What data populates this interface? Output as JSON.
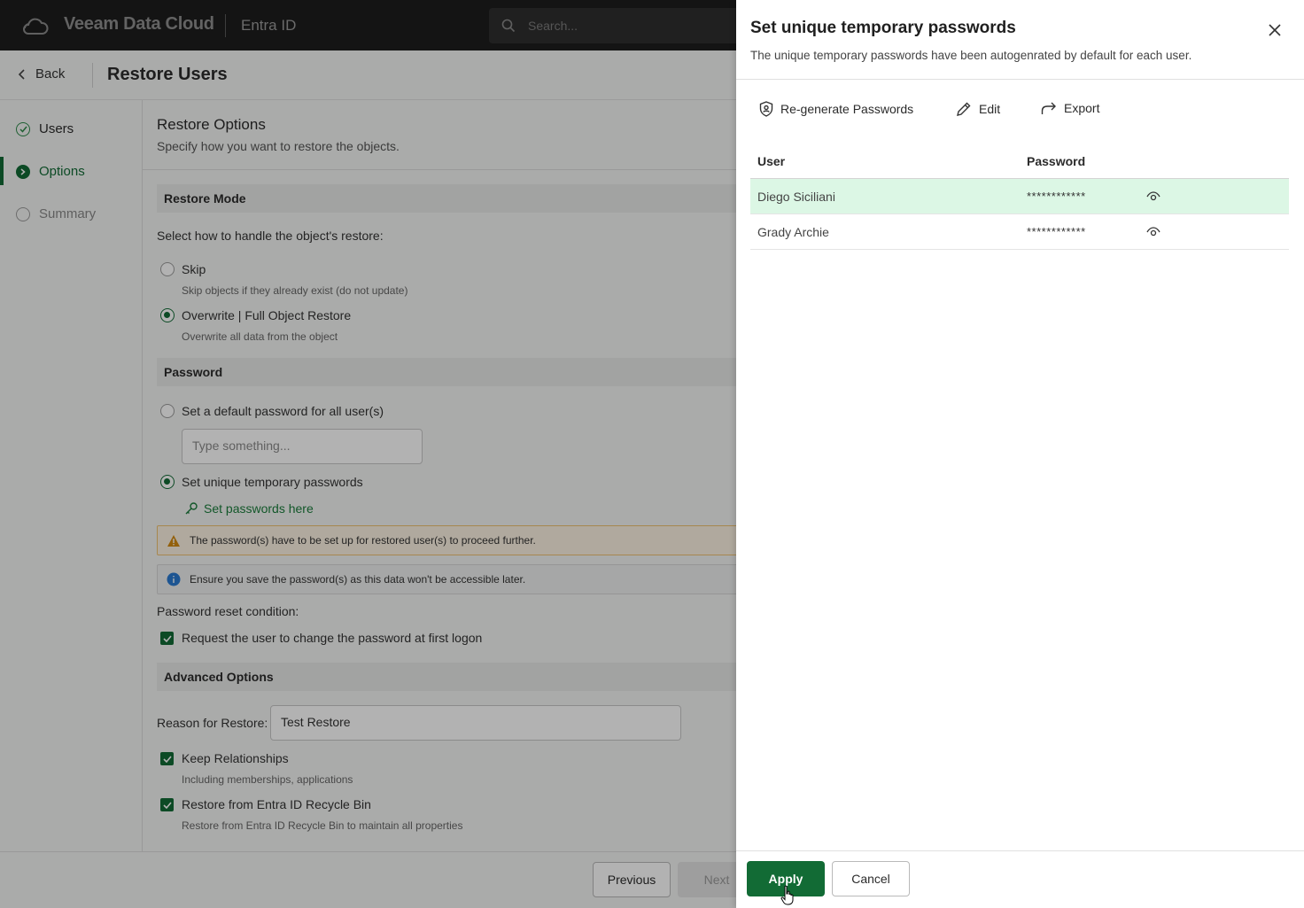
{
  "topbar": {
    "brand_name": "Veeam Data Cloud",
    "app_name": "Entra ID",
    "search_placeholder": "Search...",
    "icons": [
      "cloud-logo-icon",
      "search-icon"
    ]
  },
  "subheader": {
    "back_label": "Back",
    "page_title": "Restore Users"
  },
  "steps": [
    {
      "label": "Users",
      "state": "done"
    },
    {
      "label": "Options",
      "state": "active"
    },
    {
      "label": "Summary",
      "state": "pending"
    }
  ],
  "options": {
    "title": "Restore Options",
    "description": "Specify how you want to restore the objects.",
    "restore_mode": {
      "heading": "Restore Mode",
      "prompt": "Select how to handle the object's restore:",
      "choices": [
        {
          "label": "Skip",
          "hint": "Skip objects if they already exist (do not update)",
          "selected": false
        },
        {
          "label": "Overwrite | Full Object Restore",
          "hint": "Overwrite all data from the object",
          "selected": true
        }
      ]
    },
    "password": {
      "heading": "Password",
      "default_label": "Set a default password for all user(s)",
      "default_placeholder": "Type something...",
      "unique_label": "Set unique temporary passwords",
      "set_link": "Set passwords here",
      "warning": "The password(s) have to be set up for restored user(s) to proceed further.",
      "info": "Ensure you save the password(s) as this data won't be accessible later.",
      "reset_label": "Password reset condition:",
      "reset_checkbox": "Request the user to change the password at first logon"
    },
    "advanced": {
      "heading": "Advanced Options",
      "reason_label": "Reason for Restore:",
      "reason_value": "Test Restore",
      "keep_label": "Keep Relationships",
      "keep_hint": "Including memberships, applications",
      "recycle_label": "Restore from Entra ID Recycle Bin",
      "recycle_hint": "Restore from Entra ID Recycle Bin to maintain all properties"
    }
  },
  "footer": {
    "previous": "Previous",
    "next": "Next"
  },
  "drawer": {
    "title": "Set unique temporary passwords",
    "subtitle": "The unique temporary passwords have been autogenrated by default for each user.",
    "toolbar": {
      "regenerate": "Re-generate Passwords",
      "edit": "Edit",
      "export": "Export"
    },
    "columns": {
      "user": "User",
      "password": "Password"
    },
    "rows": [
      {
        "user": "Diego Siciliani",
        "password": "************",
        "selected": true
      },
      {
        "user": "Grady Archie",
        "password": "************",
        "selected": false
      }
    ],
    "apply": "Apply",
    "cancel": "Cancel"
  },
  "colors": {
    "accent": "#126b35",
    "row_highlight": "#dcf7e5",
    "warning_bg": "#fdf3e3",
    "topbar": "#1e1e1e"
  }
}
